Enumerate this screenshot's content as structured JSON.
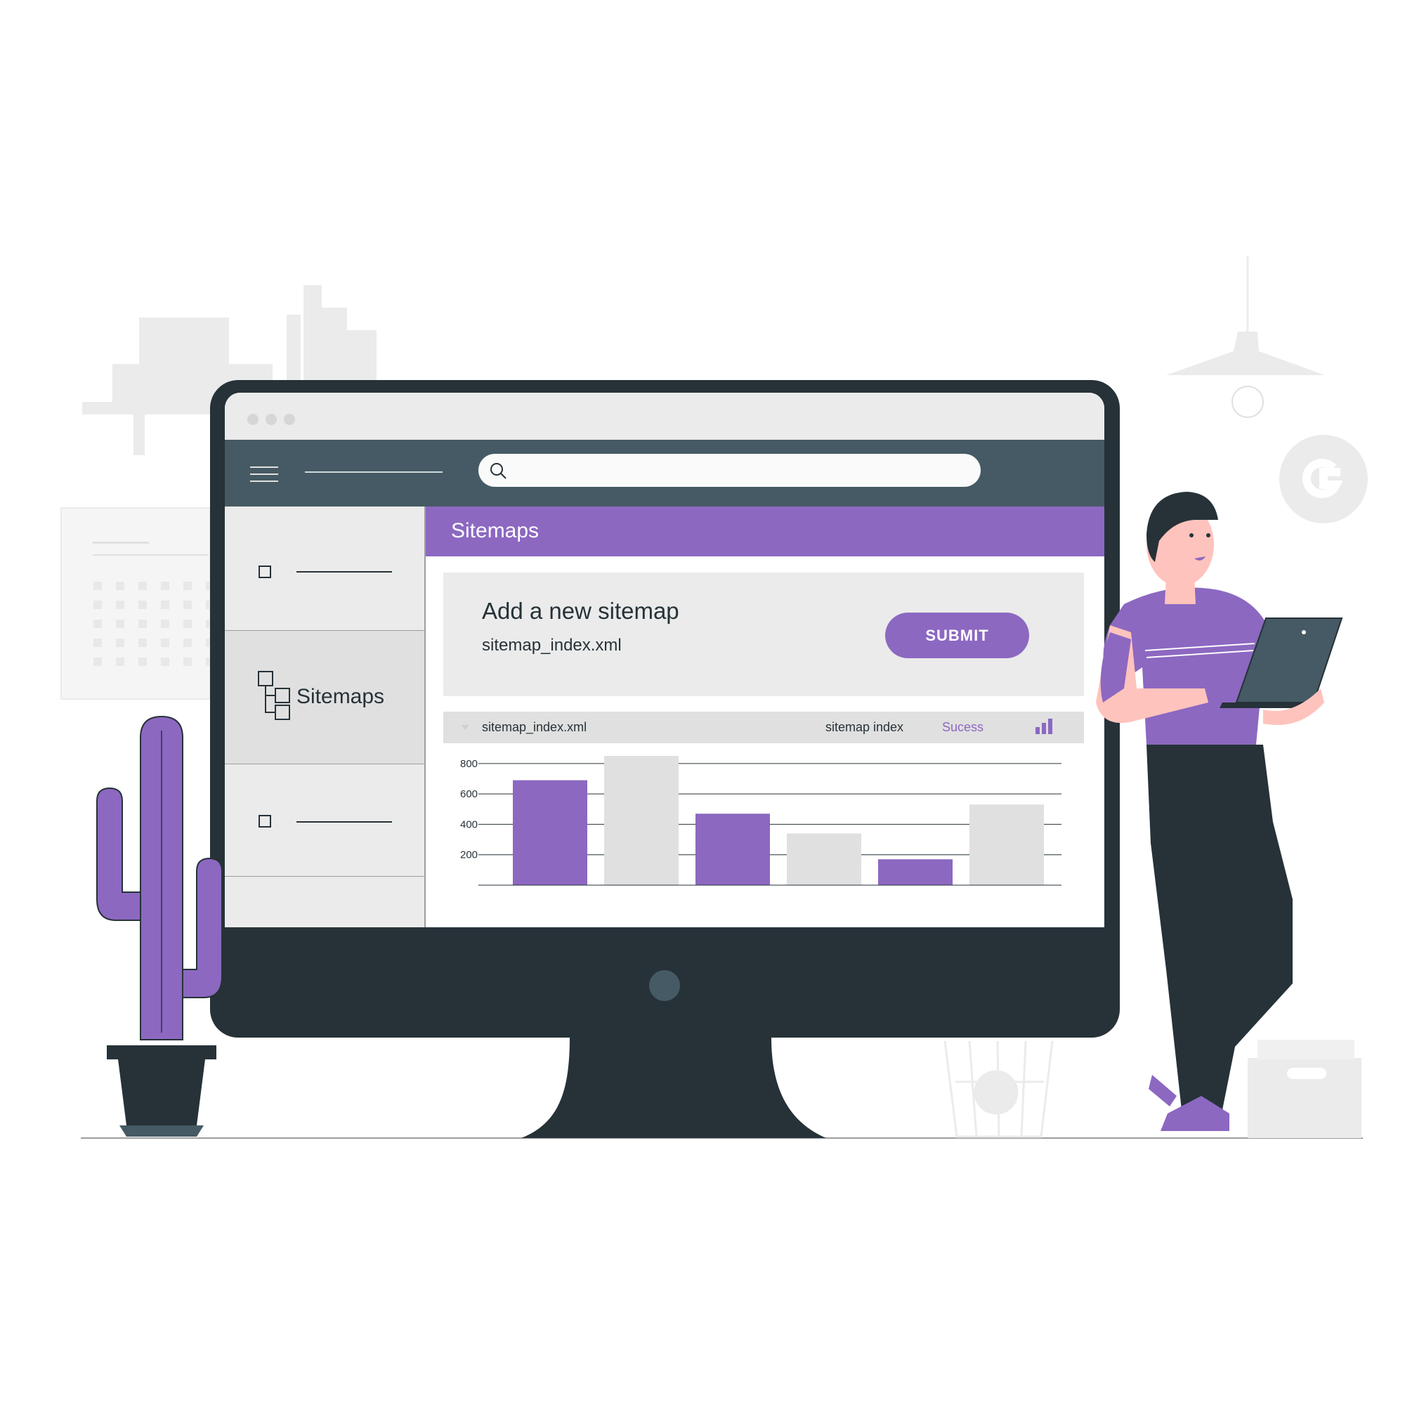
{
  "window": {
    "dots": 3
  },
  "navbar": {
    "search_placeholder": ""
  },
  "sidebar": {
    "items": [
      {
        "label": ""
      },
      {
        "label": "Sitemaps"
      },
      {
        "label": ""
      }
    ]
  },
  "page": {
    "title": "Sitemaps"
  },
  "add_sitemap": {
    "title": "Add a new sitemap",
    "value": "sitemap_index.xml",
    "submit_label": "SUBMIT"
  },
  "sitemap_row": {
    "file": "sitemap_index.xml",
    "type": "sitemap index",
    "status": "Sucess"
  },
  "colors": {
    "accent": "#8c68c1",
    "dark": "#263238",
    "slate": "#455a64",
    "light_gray": "#ebebeb",
    "bar_gray": "#e0e0e0"
  },
  "chart_data": {
    "type": "bar",
    "y_ticks": [
      "800",
      "600",
      "400",
      "200"
    ],
    "ylim": [
      0,
      850
    ],
    "values": [
      690,
      850,
      470,
      340,
      170,
      530
    ],
    "highlighted": [
      true,
      false,
      true,
      false,
      true,
      false
    ]
  }
}
